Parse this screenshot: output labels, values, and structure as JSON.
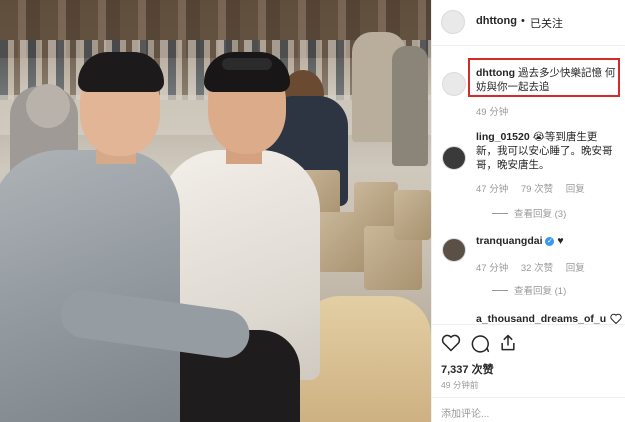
{
  "header": {
    "username": "dhttong",
    "separator": "•",
    "follow_status": "已关注"
  },
  "comments": [
    {
      "username": "dhttong",
      "text": "過去多少快樂記憶 何妨與你一起去追",
      "time": "49 分钟",
      "highlighted": true
    },
    {
      "username": "ling_01520",
      "text": "😭等到唐生更新，我可以安心睡了。晚安哥哥，晚安唐生。",
      "time": "47 分钟",
      "likes": "79 次赞",
      "reply_label": "回复",
      "view_replies": "查看回复 (3)"
    },
    {
      "username": "tranquangdai",
      "verified": true,
      "text": "♥",
      "time": "47 分钟",
      "likes": "32 次赞",
      "reply_label": "回复",
      "view_replies": "查看回复 (1)"
    },
    {
      "username": "a_thousand_dreams_of_u",
      "text": "",
      "like_icon": "heart-outline-icon"
    }
  ],
  "actions": {
    "icons": [
      "heart-outline-icon",
      "comment-icon",
      "share-icon"
    ],
    "likes_count": "7,337 次赞",
    "timestamp": "49 分钟前",
    "add_comment_placeholder": "添加评论..."
  },
  "colors": {
    "highlight_border": "#d42a2a",
    "verified_badge": "#3897f0"
  }
}
